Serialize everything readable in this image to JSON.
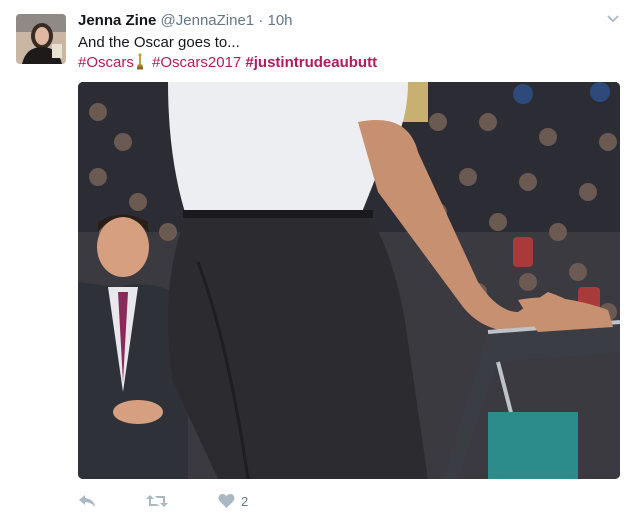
{
  "tweet": {
    "author_name": "Jenna Zine",
    "author_handle": "@JennaZine1",
    "separator": "·",
    "time": "10h",
    "text": "And the Oscar goes to...",
    "hashtags": [
      "#Oscars",
      "#Oscars2017",
      "#justintrudeaubutt"
    ],
    "likes": "2"
  },
  "icons": {
    "caret": "chevron-down-icon",
    "oscar": "oscar-statuette-icon",
    "reply": "reply-icon",
    "retweet": "retweet-icon",
    "like": "heart-icon"
  },
  "colors": {
    "hashtag": "#b31b5a",
    "muted": "#657786",
    "action_icon": "#aab8c2"
  }
}
